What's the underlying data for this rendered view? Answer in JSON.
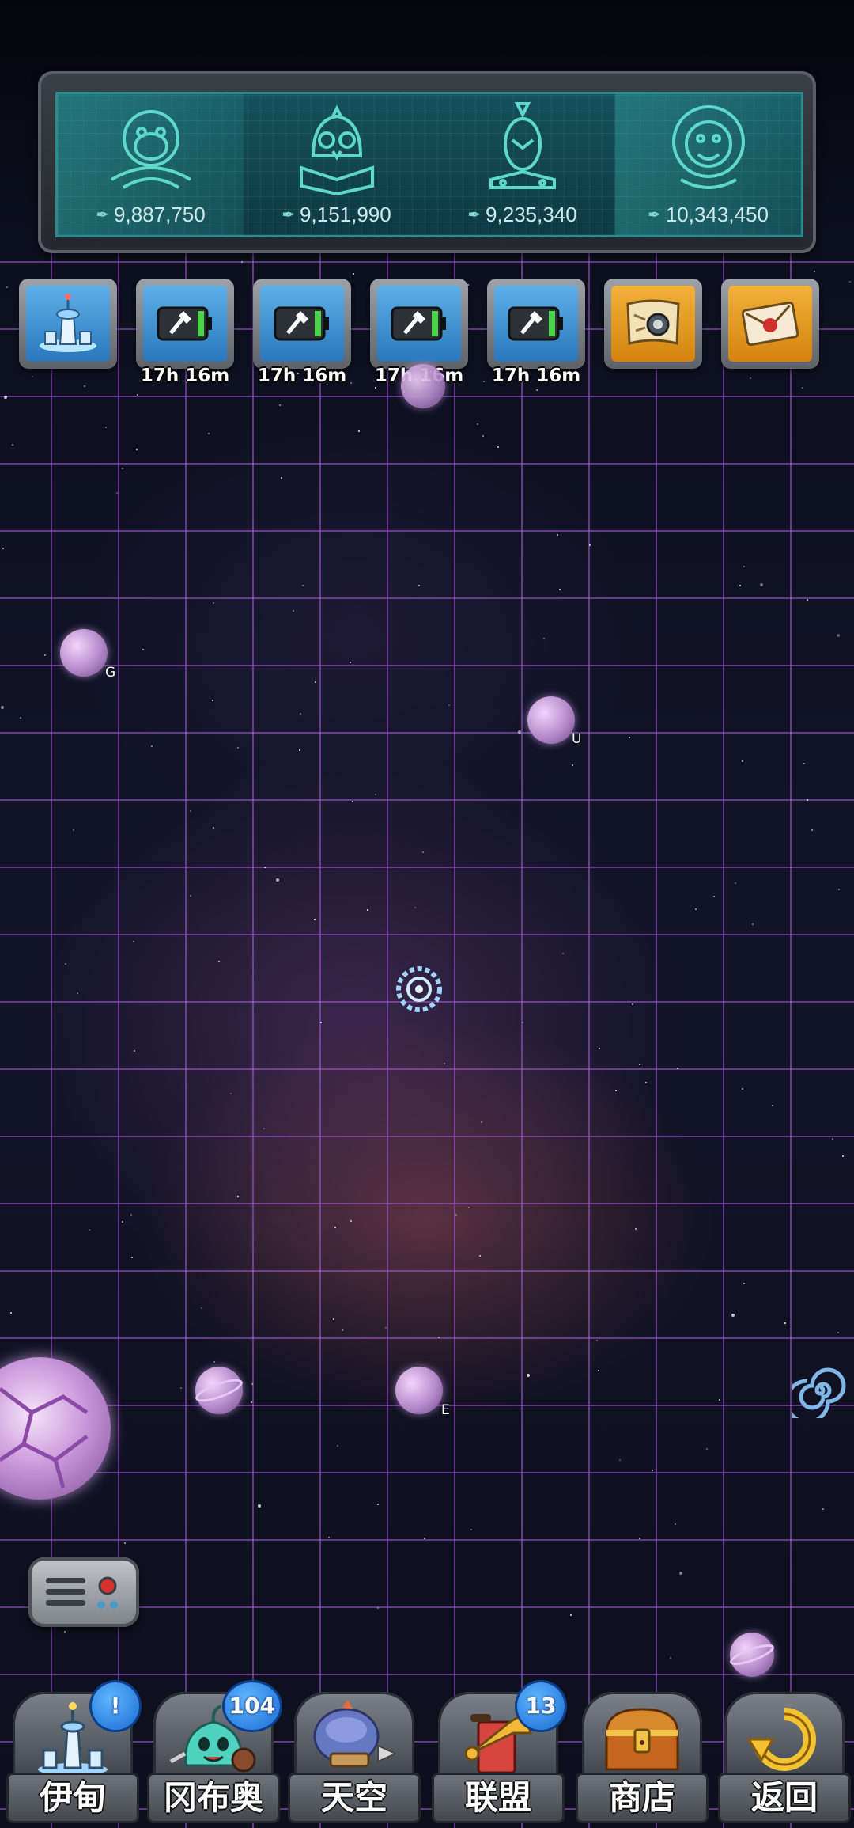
{
  "factions": [
    {
      "name": "monkey",
      "score": "9,887,750",
      "icon": "monkey-emblem-icon"
    },
    {
      "name": "owl",
      "score": "9,151,990",
      "icon": "owl-emblem-icon"
    },
    {
      "name": "bird",
      "score": "9,235,340",
      "icon": "bird-emblem-icon"
    },
    {
      "name": "lion",
      "score": "10,343,450",
      "icon": "lion-emblem-icon"
    }
  ],
  "toolbar": {
    "tools": [
      {
        "icon": "base-station-icon",
        "timer": ""
      },
      {
        "icon": "battery-shovel-icon",
        "timer": "17h 16m"
      },
      {
        "icon": "battery-shovel-icon",
        "timer": "17h 16m"
      },
      {
        "icon": "battery-shovel-icon",
        "timer": "17h 16m"
      },
      {
        "icon": "battery-shovel-icon",
        "timer": "17h 16m"
      },
      {
        "icon": "treasure-map-icon",
        "timer": ""
      },
      {
        "icon": "sealed-letter-icon",
        "timer": ""
      }
    ]
  },
  "map": {
    "planets": [
      {
        "label": "G"
      },
      {
        "label": "U"
      },
      {
        "label": "E"
      }
    ]
  },
  "nav": [
    {
      "label": "伊甸",
      "badge": "!",
      "icon": "eden-rocket-icon"
    },
    {
      "label": "冈布奥",
      "badge": "104",
      "icon": "gumball-slime-icon"
    },
    {
      "label": "天空",
      "badge": "",
      "icon": "sky-airship-icon"
    },
    {
      "label": "联盟",
      "badge": "13",
      "icon": "alliance-trumpet-icon"
    },
    {
      "label": "商店",
      "badge": "",
      "icon": "shop-chest-icon"
    },
    {
      "label": "返回",
      "badge": "",
      "icon": "return-arrow-icon"
    }
  ],
  "colors": {
    "grid": "#aa5adc",
    "panel_teal": "#15505a",
    "tool_blue": "#2a77bd",
    "tool_gold": "#d4840e",
    "badge_blue": "#1a6ad4"
  }
}
